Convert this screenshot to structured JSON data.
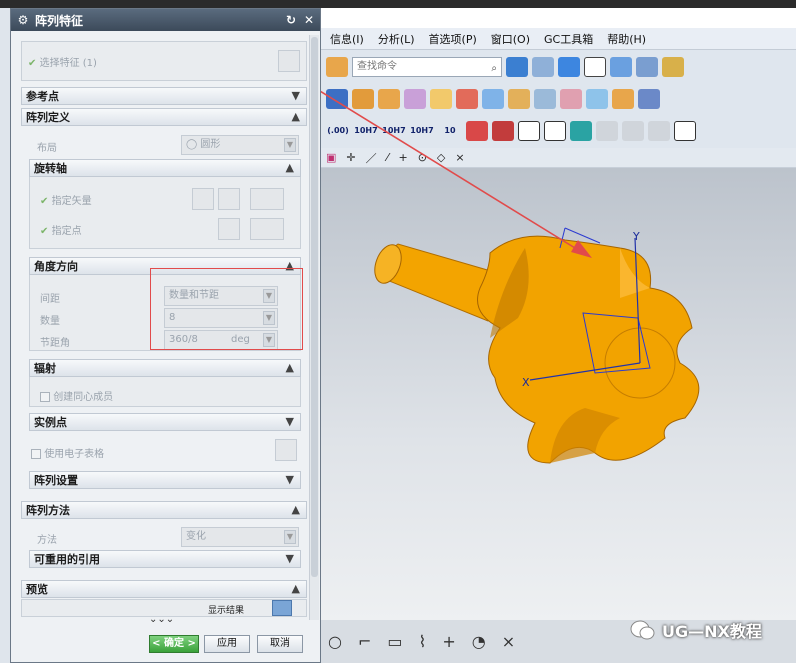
{
  "dialog": {
    "title": "阵列特征",
    "select_feature_label": "选择特征 (1)",
    "ok_label": "< 确定 >",
    "apply_label": "应用",
    "cancel_label": "取消",
    "sections": {
      "reference_point": "参考点",
      "pattern_definition": "阵列定义",
      "layout_label": "布局",
      "layout_value": "圆形",
      "rotation_axis": "旋转轴",
      "specify_vector": "指定矢量",
      "specify_point": "指定点",
      "angle_direction": "角度方向",
      "spacing_label": "间距",
      "spacing_value": "数量和节距",
      "count_label": "数量",
      "count_value": "8",
      "pitch_angle_label": "节距角",
      "pitch_angle_value": "360/8",
      "pitch_angle_unit": "deg",
      "radiate": "辐射",
      "create_concentric": "创建同心成员",
      "instance_point": "实例点",
      "use_spreadsheet": "使用电子表格",
      "pattern_settings": "阵列设置",
      "pattern_method": "阵列方法",
      "method_label": "方法",
      "method_value": "变化",
      "reusable_refs": "可重用的引用",
      "preview": "预览",
      "show_result": "显示结果"
    }
  },
  "menu": {
    "items": [
      "信息(I)",
      "分析(L)",
      "首选项(P)",
      "窗口(O)",
      "GC工具箱",
      "帮助(H)"
    ]
  },
  "toolbar": {
    "search_placeholder": "查找命令",
    "fit_labels": [
      "(.00)",
      "10H7",
      "10H7",
      "10H7",
      "10"
    ]
  },
  "viewport": {
    "axis_x": "X",
    "axis_y": "Y"
  },
  "watermark": {
    "text": "UG—NX教程"
  },
  "colors": {
    "part_orange": "#f0a100",
    "callout_red": "#e14b4b",
    "dialog_title_bg": "#4a5a6c",
    "ok_green": "#3aa13a"
  }
}
